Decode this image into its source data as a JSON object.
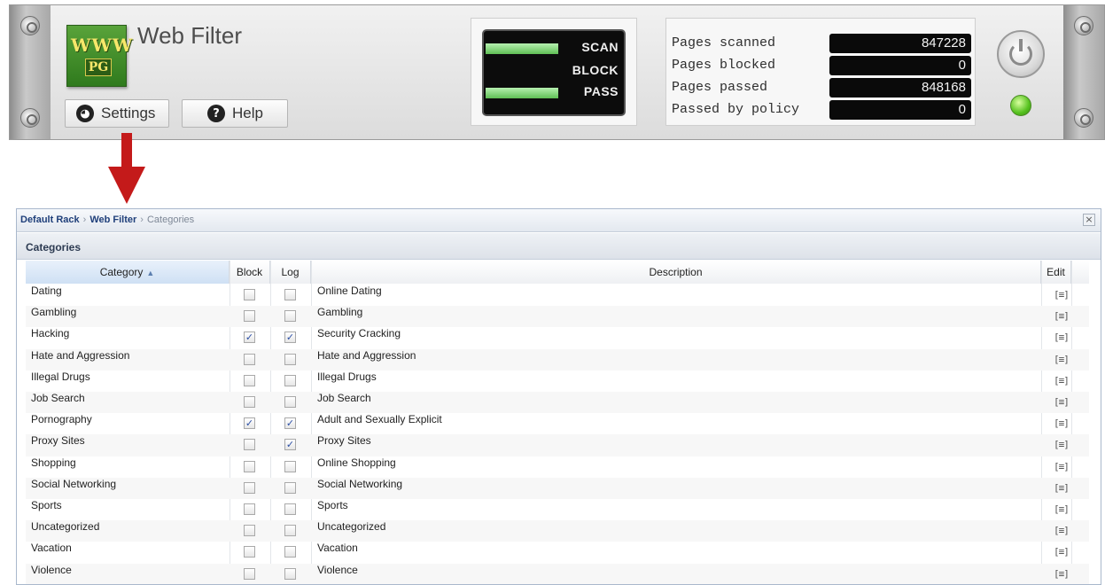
{
  "rack": {
    "logo": {
      "line1": "WWW",
      "line2": "PG"
    },
    "app_title": "Web Filter",
    "buttons": {
      "settings": "Settings",
      "help": "Help"
    },
    "status": [
      {
        "label": "SCAN",
        "active": true
      },
      {
        "label": "BLOCK",
        "active": false
      },
      {
        "label": "PASS",
        "active": true
      }
    ],
    "metrics": [
      {
        "label": "Pages scanned",
        "value": "847228"
      },
      {
        "label": "Pages blocked",
        "value": "0"
      },
      {
        "label": "Pages passed",
        "value": "848168"
      },
      {
        "label": "Passed by policy",
        "value": "0"
      }
    ],
    "status_led_color": "#55c11e",
    "power_icon": "power-icon"
  },
  "arrow_color": "#c41a1a",
  "window": {
    "breadcrumb": [
      "Default Rack",
      "Web Filter",
      "Categories"
    ],
    "close_glyph": "×",
    "panel_title": "Categories",
    "columns": {
      "category": "Category",
      "block": "Block",
      "log": "Log",
      "description": "Description",
      "edit": "Edit"
    },
    "sort_indicator": "▲",
    "rows": [
      {
        "category": "Dating",
        "block": false,
        "log": false,
        "description": "Online Dating"
      },
      {
        "category": "Gambling",
        "block": false,
        "log": false,
        "description": "Gambling"
      },
      {
        "category": "Hacking",
        "block": true,
        "log": true,
        "description": "Security Cracking"
      },
      {
        "category": "Hate and Aggression",
        "block": false,
        "log": false,
        "description": "Hate and Aggression"
      },
      {
        "category": "Illegal Drugs",
        "block": false,
        "log": false,
        "description": "Illegal Drugs"
      },
      {
        "category": "Job Search",
        "block": false,
        "log": false,
        "description": "Job Search"
      },
      {
        "category": "Pornography",
        "block": true,
        "log": true,
        "description": "Adult and Sexually Explicit"
      },
      {
        "category": "Proxy Sites",
        "block": false,
        "log": true,
        "description": "Proxy Sites"
      },
      {
        "category": "Shopping",
        "block": false,
        "log": false,
        "description": "Online Shopping"
      },
      {
        "category": "Social Networking",
        "block": false,
        "log": false,
        "description": "Social Networking"
      },
      {
        "category": "Sports",
        "block": false,
        "log": false,
        "description": "Sports"
      },
      {
        "category": "Uncategorized",
        "block": false,
        "log": false,
        "description": "Uncategorized"
      },
      {
        "category": "Vacation",
        "block": false,
        "log": false,
        "description": "Vacation"
      },
      {
        "category": "Violence",
        "block": false,
        "log": false,
        "description": "Violence"
      }
    ]
  }
}
